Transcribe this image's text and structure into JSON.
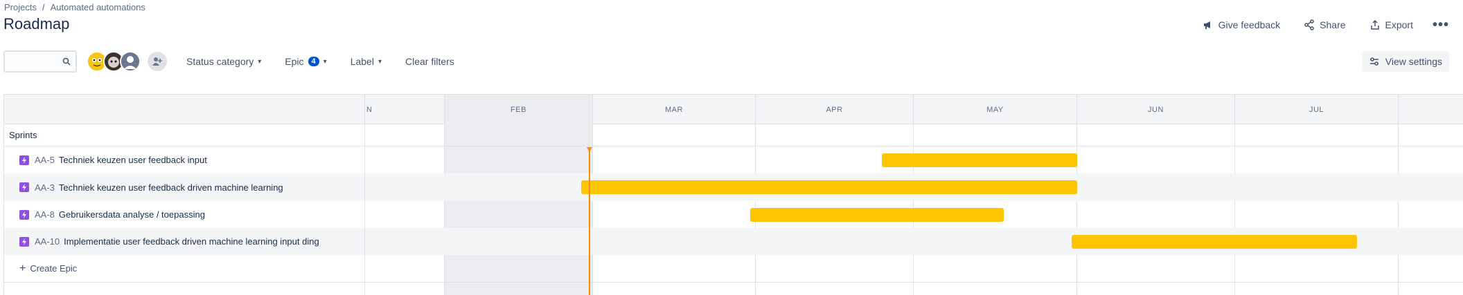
{
  "breadcrumb": {
    "projects": "Projects",
    "separator": "/",
    "project": "Automated automations"
  },
  "page": {
    "title": "Roadmap"
  },
  "header_actions": {
    "feedback": "Give feedback",
    "share": "Share",
    "export": "Export",
    "more": "•••"
  },
  "filters": {
    "search_placeholder": "",
    "status_category": "Status category",
    "epic": "Epic",
    "epic_count": "4",
    "label": "Label",
    "clear": "Clear filters",
    "view_settings": "View settings"
  },
  "timeline": {
    "months": [
      "N",
      "FEB",
      "MAR",
      "APR",
      "MAY",
      "JUN",
      "JUL"
    ],
    "sprints_label": "Sprints",
    "create_epic": "Create Epic",
    "epics": [
      {
        "key": "AA-5",
        "title": "Techniek keuzen user feedback input"
      },
      {
        "key": "AA-3",
        "title": "Techniek keuzen user feedback driven machine learning"
      },
      {
        "key": "AA-8",
        "title": "Gebruikersdata analyse / toepassing"
      },
      {
        "key": "AA-10",
        "title": "Implementatie user feedback driven machine learning input ding"
      }
    ]
  },
  "colors": {
    "bar": "#ffc400",
    "today": "#ff8b00",
    "epic_icon": "#904ee2",
    "badge": "#0052cc"
  }
}
